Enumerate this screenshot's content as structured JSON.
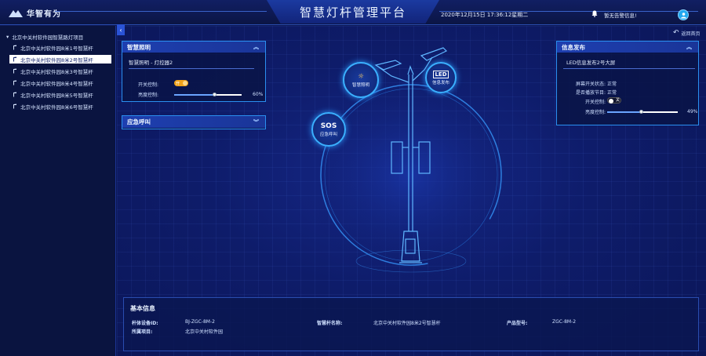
{
  "header": {
    "logo_text": "华智有为",
    "title": "智慧灯杆管理平台",
    "datetime": "2020年12月15日 17:36:12星期二",
    "alarm_text": "暂无告警信息!"
  },
  "sidebar": {
    "root_label": "北京中关村软件园智慧路灯项目",
    "items": [
      {
        "label": "北京中关村软件园8米1号智慧杆",
        "active": false
      },
      {
        "label": "北京中关村软件园8米2号智慧杆",
        "active": true
      },
      {
        "label": "北京中关村软件园8米3号智慧杆",
        "active": false
      },
      {
        "label": "北京中关村软件园8米4号智慧杆",
        "active": false
      },
      {
        "label": "北京中关村软件园8米5号智慧杆",
        "active": false
      },
      {
        "label": "北京中关村软件园8米6号智慧杆",
        "active": false
      }
    ]
  },
  "back_label": "返回首页",
  "lighting_panel": {
    "title": "智慧照明",
    "subtitle": "智慧照明 - 灯控器2",
    "switch_label": "开关控制:",
    "switch_state": "开",
    "brightness_label": "亮度控制:",
    "brightness_value": "60%",
    "brightness_fraction": 0.6
  },
  "emergency_panel": {
    "title": "应急呼叫"
  },
  "led_panel": {
    "title": "信息发布",
    "subtitle": "LED信息发布2号大屏",
    "screen_switch_label": "屏幕开关状态:",
    "screen_switch_value": "正常",
    "playing_label": "是否播放节目:",
    "playing_value": "正常",
    "switch_label": "开关控制:",
    "switch_state": "关",
    "brightness_label": "亮度控制:",
    "brightness_value": "49%",
    "brightness_fraction": 0.49
  },
  "scene": {
    "lighting_badge": "智慧照明",
    "led_badge": "信息发布",
    "led_icon": "LED",
    "sos_badge": "应急呼叫",
    "sos_icon": "SOS"
  },
  "info": {
    "title": "基本信息",
    "device_id_label": "杆体设备ID:",
    "device_id_value": "BJ-ZGC-8M-2",
    "pole_name_label": "智慧杆名称:",
    "pole_name_value": "北京中关村软件园8米2号智慧杆",
    "model_label": "产品型号:",
    "model_value": "ZGC-8M-2",
    "project_label": "所属项目:",
    "project_value": "北京中关村软件园"
  },
  "colors": {
    "accent": "#2a8ff0",
    "toggle_on": "#f0a21b",
    "bg": "#0c1752"
  }
}
